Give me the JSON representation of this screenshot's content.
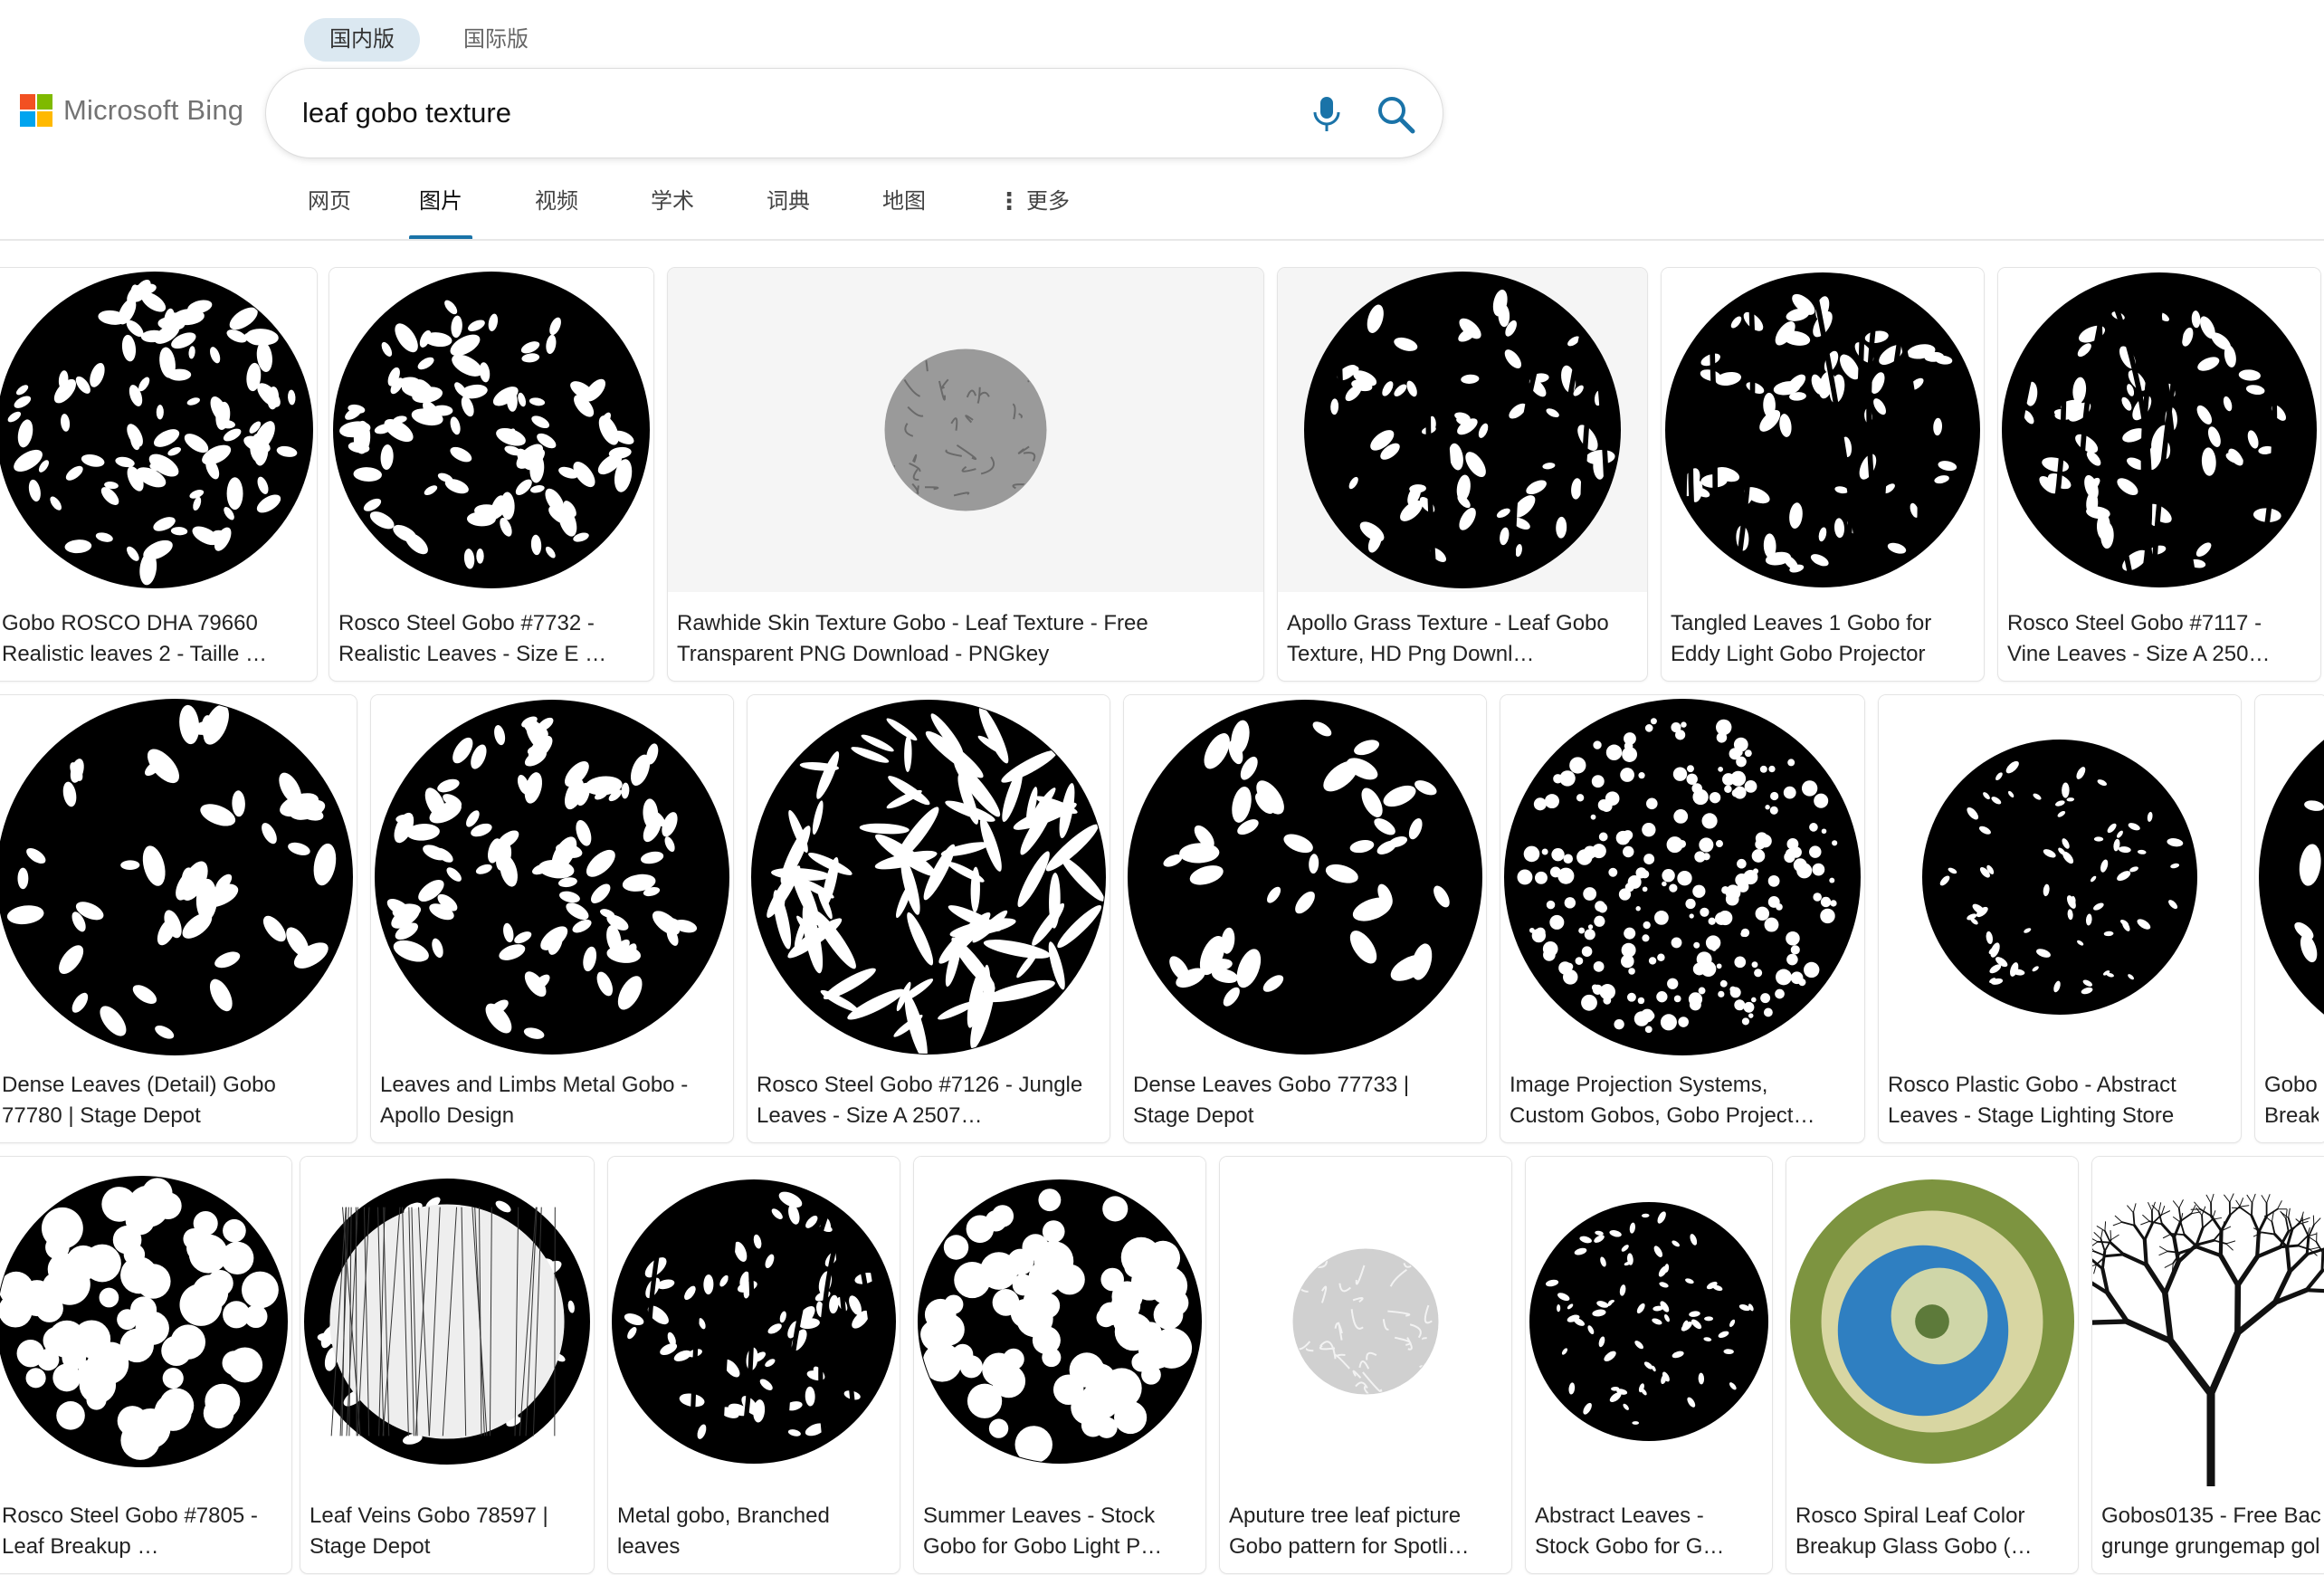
{
  "region_tabs": [
    {
      "label": "国内版",
      "active": true
    },
    {
      "label": "国际版",
      "active": false
    }
  ],
  "logo": {
    "text": "Microsoft Bing",
    "colors": [
      "#f25022",
      "#7fba00",
      "#00a4ef",
      "#ffb900"
    ]
  },
  "search": {
    "value": "leaf gobo texture",
    "placeholder": ""
  },
  "scopes": [
    {
      "label": "网页",
      "active": false
    },
    {
      "label": "图片",
      "active": true
    },
    {
      "label": "视频",
      "active": false
    },
    {
      "label": "学术",
      "active": false
    },
    {
      "label": "词典",
      "active": false
    },
    {
      "label": "地图",
      "active": false
    },
    {
      "label": "更多",
      "active": false
    }
  ],
  "colors": {
    "accent": "#1a73a8",
    "icon_blue": "#1a73a8"
  },
  "results": {
    "rows": [
      [
        {
          "line1": "Gobo ROSCO DHA 79660",
          "line2": "Realistic leaves 2 - Taille …",
          "style": "leaves-dense"
        },
        {
          "line1": "Rosco Steel Gobo #7732 -",
          "line2": "Realistic Leaves - Size E …",
          "style": "leaves-dense"
        },
        {
          "line1": "Rawhide Skin Texture Gobo - Leaf Texture - Free",
          "line2": "Transparent PNG Download - PNGkey",
          "style": "grey-veins"
        },
        {
          "line1": "Apollo Grass Texture - Leaf Gobo",
          "line2": "Texture, HD Png Downl…",
          "style": "grass"
        },
        {
          "line1": "Tangled Leaves 1 Gobo for",
          "line2": "Eddy Light Gobo Projector",
          "style": "vine"
        },
        {
          "line1": "Rosco Steel Gobo #7117 -",
          "line2": "Vine Leaves - Size A 250…",
          "style": "vine"
        }
      ],
      [
        {
          "line1": "Dense Leaves (Detail) Gobo",
          "line2": "77780 | Stage Depot",
          "style": "leaves-sparse"
        },
        {
          "line1": "Leaves and Limbs Metal Gobo -",
          "line2": "Apollo Design",
          "style": "leaves-dense"
        },
        {
          "line1": "Rosco Steel Gobo #7126 - Jungle",
          "line2": "Leaves - Size A 2507…",
          "style": "fronds"
        },
        {
          "line1": "Dense Leaves Gobo 77733 |",
          "line2": "Stage Depot",
          "style": "leaves-sparse"
        },
        {
          "line1": "Image Projection Systems,",
          "line2": "Custom Gobos, Gobo Project…",
          "style": "speckle"
        },
        {
          "line1": "Rosco Plastic Gobo - Abstract",
          "line2": "Leaves - Stage Lighting Store",
          "style": "abstract-small"
        },
        {
          "line1": "Gobo",
          "line2": "Break",
          "style": "leaves-sparse"
        }
      ],
      [
        {
          "line1": "Rosco Steel Gobo #7805 -",
          "line2": "Leaf Breakup …",
          "style": "blobs"
        },
        {
          "line1": "Leaf Veins Gobo 78597 |",
          "line2": "Stage Depot",
          "style": "veins"
        },
        {
          "line1": "Metal gobo, Branched",
          "line2": "leaves",
          "style": "branched"
        },
        {
          "line1": "Summer Leaves - Stock",
          "line2": "Gobo for Gobo Light P…",
          "style": "blobs"
        },
        {
          "line1": "Aputure tree leaf picture",
          "line2": "Gobo pattern for Spotli…",
          "style": "silver"
        },
        {
          "line1": "Abstract Leaves -",
          "line2": "Stock Gobo for G…",
          "style": "abstract"
        },
        {
          "line1": "Rosco Spiral Leaf Color",
          "line2": "Breakup Glass Gobo (…",
          "style": "color-spiral"
        },
        {
          "line1": "Gobos0135 - Free Bac",
          "line2": "grunge grungemap gol",
          "style": "tree"
        }
      ]
    ]
  }
}
